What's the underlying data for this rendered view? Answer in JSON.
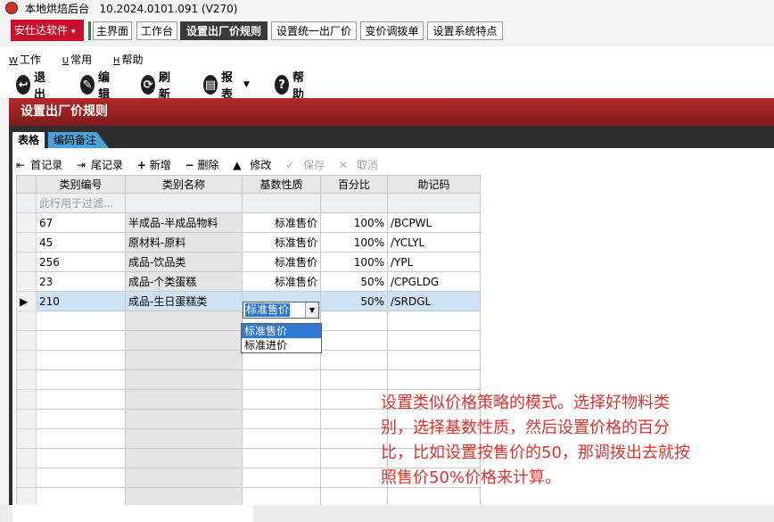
{
  "window": {
    "title": "本地烘焙后台",
    "version": "10.2024.0101.091 (V270)"
  },
  "brand": {
    "label": "安仕达软件"
  },
  "main_tabs": [
    "主界面",
    "工作台",
    "设置出厂价规则",
    "设置统一出厂价",
    "变价调拨单",
    "设置系统特点"
  ],
  "menu": [
    {
      "key": "W",
      "label": "工作"
    },
    {
      "key": "U",
      "label": "常用"
    },
    {
      "key": "H",
      "label": "帮助"
    }
  ],
  "toolbar": {
    "exit": "退出",
    "edit": "编辑",
    "refresh": "刷新",
    "report": "报表",
    "help": "帮助"
  },
  "panel": {
    "title": "设置出厂价规则"
  },
  "sub_tabs": [
    "表格",
    "编码备注"
  ],
  "nav": {
    "first": "首记录",
    "last": "尾记录",
    "add": "新增",
    "delete": "删除",
    "modify": "修改",
    "save": "保存",
    "cancel": "取消"
  },
  "grid": {
    "columns": [
      "类别编号",
      "类别名称",
      "基数性质",
      "百分比",
      "助记码"
    ],
    "filter_placeholder": "此行用于过滤...",
    "rows": [
      {
        "code": "67",
        "name": "半成品-半成品物料",
        "base": "标准售价",
        "pct": "100%",
        "mnemonic": "/BCPWL"
      },
      {
        "code": "45",
        "name": "原材料-原料",
        "base": "标准售价",
        "pct": "100%",
        "mnemonic": "/YCLYL"
      },
      {
        "code": "256",
        "name": "成品-饮品类",
        "base": "标准售价",
        "pct": "100%",
        "mnemonic": "/YPL"
      },
      {
        "code": "23",
        "name": "成品-个类蛋糕",
        "base": "标准售价",
        "pct": "50%",
        "mnemonic": "/CPGLDG"
      },
      {
        "code": "210",
        "name": "成品-生日蛋糕类",
        "base": "标准售价",
        "pct": "50%",
        "mnemonic": "/SRDGL"
      }
    ],
    "editor_value": "标准售价",
    "dropdown_options": [
      "标准售价",
      "标准进价"
    ]
  },
  "annotation": {
    "line1": "设置类似价格策略的模式。选择好物料类",
    "line2": "别，选择基数性质，然后设置价格的百分",
    "line3": "比，比如设置按售价的50，那调拨出去就按",
    "line4": "照售价50%价格来计算。"
  },
  "colors": {
    "brand": "#c8102e",
    "header_bar": "#9e2424",
    "selection": "#cfe3f7",
    "annotation": "#e0332f"
  }
}
